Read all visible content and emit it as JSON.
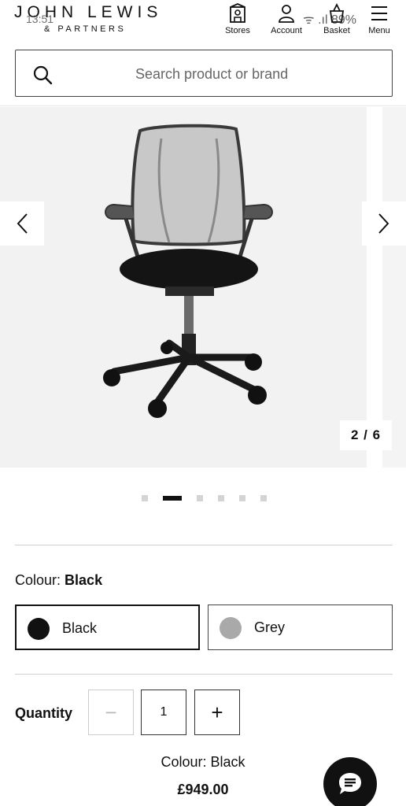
{
  "status_bar": {
    "time": "13:51",
    "battery": "89%"
  },
  "brand": {
    "line1": "JOHN LEWIS",
    "line2": "& PARTNERS"
  },
  "nav": [
    {
      "label": "Stores",
      "icon": "store-icon"
    },
    {
      "label": "Account",
      "icon": "account-icon"
    },
    {
      "label": "Basket",
      "icon": "basket-icon"
    },
    {
      "label": "Menu",
      "icon": "menu-icon"
    }
  ],
  "search": {
    "placeholder": "Search product or brand"
  },
  "gallery": {
    "counter": "2 / 6",
    "current": 2,
    "total": 6
  },
  "colour": {
    "heading_label": "Colour:",
    "heading_value": "Black",
    "options": [
      {
        "label": "Black",
        "color": "#111111",
        "selected": true
      },
      {
        "label": "Grey",
        "color": "#a9a9a9",
        "selected": false
      }
    ]
  },
  "quantity": {
    "label": "Quantity",
    "value": "1",
    "minus": "−",
    "plus": "+"
  },
  "summary": {
    "colour_text": "Colour: Black",
    "price": "£949.00"
  },
  "colors": {
    "accent": "#111111",
    "border": "#cfcfcf"
  }
}
